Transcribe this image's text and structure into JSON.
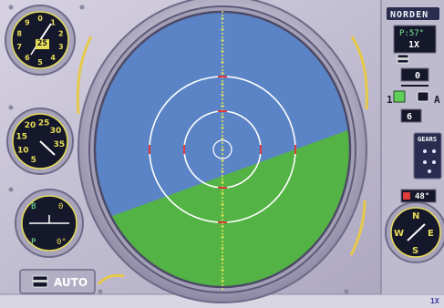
{
  "colors": {
    "sky": "#5b84c6",
    "ground": "#54b345",
    "panel": "#c9c5d6",
    "panel_shadow": "#8f8aa6",
    "gauge_face": "#15172a",
    "gauge_marking": "#e7dc5a",
    "reticle": "#ffffff",
    "tick_yellow": "#e6e65a",
    "tick_red": "#e03a3a"
  },
  "icons": {
    "altimeter": "altimeter-dial-icon",
    "airspeed": "airspeed-dial-icon",
    "attitude": "attitude-indicator-icon",
    "compass": "compass-dial-icon",
    "reticle": "crosshair-reticle-icon"
  },
  "bombsight": {
    "title": "NORDEN",
    "pitch_readout": "P:57°",
    "magnification": "1X",
    "altitude_setting": "0",
    "bay_number": "1",
    "mode_letter": "A",
    "release_count": "6",
    "temperature": "48°"
  },
  "gears": {
    "label": "GEARS"
  },
  "altimeter": {
    "value": "25",
    "dial_numbers": [
      "0",
      "1",
      "2",
      "3",
      "4",
      "5",
      "6",
      "7",
      "8",
      "9"
    ]
  },
  "airspeed": {
    "dial_numbers": [
      "5",
      "10",
      "15",
      "20",
      "25",
      "30",
      "35"
    ]
  },
  "attitude": {
    "top_value": "0",
    "bottom_value": "0°",
    "top_prefix": "B",
    "bottom_prefix": "P"
  },
  "compass": {
    "north": "N",
    "east": "E",
    "south": "S",
    "west": "W"
  },
  "autopilot": {
    "label": "AUTO"
  },
  "speed": {
    "label": "1X"
  },
  "horizon": {
    "bank_degrees": -20,
    "pitch_offset": 0.48
  }
}
